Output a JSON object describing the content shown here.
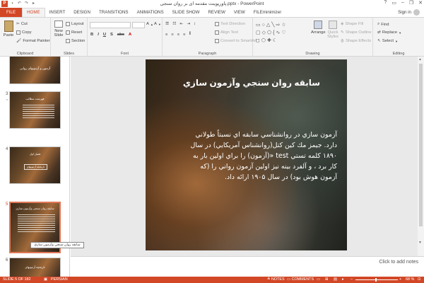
{
  "window": {
    "title": "پاورپوینت مقدمه ای بر روان سنجی.pptx - PowerPoint",
    "app_logo": "P",
    "controls": [
      "?",
      "▭",
      "–",
      "❐",
      "✕"
    ]
  },
  "tabs": [
    "FILE",
    "HOME",
    "INSERT",
    "DESIGN",
    "TRANSITIONS",
    "ANIMATIONS",
    "SLIDE SHOW",
    "REVIEW",
    "VIEW",
    "FILEminimizer"
  ],
  "active_tab": "HOME",
  "signin": "Sign in",
  "ribbon": {
    "clipboard": {
      "label": "Clipboard",
      "paste": "Paste",
      "cut": "Cut",
      "copy": "Copy",
      "format_painter": "Format Painter"
    },
    "slides": {
      "label": "Slides",
      "new_slide_line1": "New",
      "new_slide_line2": "Slide",
      "layout": "Layout",
      "reset": "Reset",
      "section": "Section"
    },
    "font": {
      "label": "Font"
    },
    "paragraph": {
      "label": "Paragraph",
      "text_direction": "Text Direction",
      "align_text": "Align Text",
      "convert_smartart": "Convert to SmartArt"
    },
    "drawing": {
      "label": "Drawing",
      "arrange": "Arrange",
      "quick_styles_line1": "Quick",
      "quick_styles_line2": "Styles",
      "shape_fill": "Shape Fill",
      "shape_outline": "Shape Outline",
      "shape_effects": "Shape Effects"
    },
    "editing": {
      "label": "Editing",
      "find": "Find",
      "replace": "Replace",
      "select": "Select"
    }
  },
  "thumbnails": [
    {
      "num": "",
      "title": "آزمون و آزمونهای روانی"
    },
    {
      "num": "3",
      "title": "فهرست مطالب",
      "star": "*"
    },
    {
      "num": "4",
      "title": "فصل اول",
      "box": "تاریخچه آزمونهای"
    },
    {
      "num": "5",
      "title": "سابقه روان سنجی وآزمون سازی",
      "selected": true
    },
    {
      "num": "6",
      "title": "تاریخچه آزمونهای"
    }
  ],
  "tooltip": "سابقه روان سنجي وآزمون سازي",
  "slide": {
    "title": "سابقه روان سنجي وآزمون سازي",
    "body": "آزمون سازي در روانشناسي سابقه اي نسبتاً طولاني دارد. جيمز مك كين كتل(روانشناس آمريكايي) در سال ۱۸۹۰ كلمه تستي test «(آزمون) را براي اولين بار به كار برد ، و آلفرد بينه نيز اولين آزمون رواني را (كه آزمون هوش بود) در سال ۱۹۰۵ ارائه داد."
  },
  "notes_placeholder": "Click to add notes",
  "status": {
    "slide_info": "SLIDE 5 OF 182",
    "language": "PERSIAN",
    "notes": "NOTES",
    "comments": "COMMENTS",
    "zoom": "68 %"
  }
}
